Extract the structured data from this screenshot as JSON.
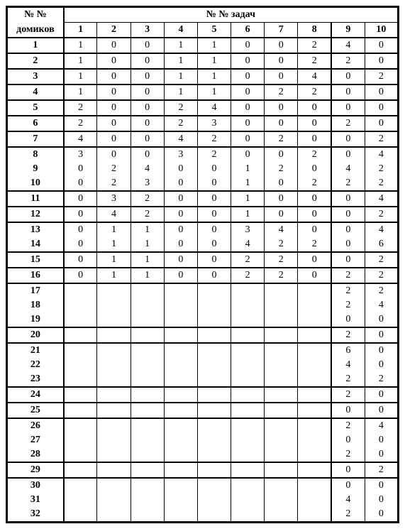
{
  "header": {
    "row_label_top": "№ №",
    "row_label_bottom": "домиков",
    "col_group_label": "№ №  задач",
    "columns": [
      "1",
      "2",
      "3",
      "4",
      "5",
      "6",
      "7",
      "8",
      "9",
      "10"
    ]
  },
  "group_starts": [
    1,
    2,
    3,
    4,
    5,
    6,
    7,
    8,
    11,
    12,
    13,
    15,
    16,
    17,
    20,
    21,
    24,
    25,
    26,
    29,
    30
  ],
  "rows": [
    {
      "n": "1",
      "v": [
        "1",
        "0",
        "0",
        "1",
        "1",
        "0",
        "0",
        "2",
        "4",
        "0"
      ]
    },
    {
      "n": "2",
      "v": [
        "1",
        "0",
        "0",
        "1",
        "1",
        "0",
        "0",
        "2",
        "2",
        "0"
      ]
    },
    {
      "n": "3",
      "v": [
        "1",
        "0",
        "0",
        "1",
        "1",
        "0",
        "0",
        "4",
        "0",
        "2"
      ]
    },
    {
      "n": "4",
      "v": [
        "1",
        "0",
        "0",
        "1",
        "1",
        "0",
        "2",
        "2",
        "0",
        "0"
      ]
    },
    {
      "n": "5",
      "v": [
        "2",
        "0",
        "0",
        "2",
        "4",
        "0",
        "0",
        "0",
        "0",
        "0"
      ]
    },
    {
      "n": "6",
      "v": [
        "2",
        "0",
        "0",
        "2",
        "3",
        "0",
        "0",
        "0",
        "2",
        "0"
      ]
    },
    {
      "n": "7",
      "v": [
        "4",
        "0",
        "0",
        "4",
        "2",
        "0",
        "2",
        "0",
        "0",
        "2"
      ]
    },
    {
      "n": "8",
      "v": [
        "3",
        "0",
        "0",
        "3",
        "2",
        "0",
        "0",
        "2",
        "0",
        "4"
      ]
    },
    {
      "n": "9",
      "v": [
        "0",
        "2",
        "4",
        "0",
        "0",
        "1",
        "2",
        "0",
        "4",
        "2"
      ]
    },
    {
      "n": "10",
      "v": [
        "0",
        "2",
        "3",
        "0",
        "0",
        "1",
        "0",
        "2",
        "2",
        "2"
      ]
    },
    {
      "n": "11",
      "v": [
        "0",
        "3",
        "2",
        "0",
        "0",
        "1",
        "0",
        "0",
        "0",
        "4"
      ]
    },
    {
      "n": "12",
      "v": [
        "0",
        "4",
        "2",
        "0",
        "0",
        "1",
        "0",
        "0",
        "0",
        "2"
      ]
    },
    {
      "n": "13",
      "v": [
        "0",
        "1",
        "1",
        "0",
        "0",
        "3",
        "4",
        "0",
        "0",
        "4"
      ]
    },
    {
      "n": "14",
      "v": [
        "0",
        "1",
        "1",
        "0",
        "0",
        "4",
        "2",
        "2",
        "0",
        "6"
      ]
    },
    {
      "n": "15",
      "v": [
        "0",
        "1",
        "1",
        "0",
        "0",
        "2",
        "2",
        "0",
        "0",
        "2"
      ]
    },
    {
      "n": "16",
      "v": [
        "0",
        "1",
        "1",
        "0",
        "0",
        "2",
        "2",
        "0",
        "2",
        "2"
      ]
    },
    {
      "n": "17",
      "v": [
        "",
        "",
        "",
        "",
        "",
        "",
        "",
        "",
        "2",
        "2"
      ]
    },
    {
      "n": "18",
      "v": [
        "",
        "",
        "",
        "",
        "",
        "",
        "",
        "",
        "2",
        "4"
      ]
    },
    {
      "n": "19",
      "v": [
        "",
        "",
        "",
        "",
        "",
        "",
        "",
        "",
        "0",
        "0"
      ]
    },
    {
      "n": "20",
      "v": [
        "",
        "",
        "",
        "",
        "",
        "",
        "",
        "",
        "2",
        "0"
      ]
    },
    {
      "n": "21",
      "v": [
        "",
        "",
        "",
        "",
        "",
        "",
        "",
        "",
        "6",
        "0"
      ]
    },
    {
      "n": "22",
      "v": [
        "",
        "",
        "",
        "",
        "",
        "",
        "",
        "",
        "4",
        "0"
      ]
    },
    {
      "n": "23",
      "v": [
        "",
        "",
        "",
        "",
        "",
        "",
        "",
        "",
        "2",
        "2"
      ]
    },
    {
      "n": "24",
      "v": [
        "",
        "",
        "",
        "",
        "",
        "",
        "",
        "",
        "2",
        "0"
      ]
    },
    {
      "n": "25",
      "v": [
        "",
        "",
        "",
        "",
        "",
        "",
        "",
        "",
        "0",
        "0"
      ]
    },
    {
      "n": "26",
      "v": [
        "",
        "",
        "",
        "",
        "",
        "",
        "",
        "",
        "2",
        "4"
      ]
    },
    {
      "n": "27",
      "v": [
        "",
        "",
        "",
        "",
        "",
        "",
        "",
        "",
        "0",
        "0"
      ]
    },
    {
      "n": "28",
      "v": [
        "",
        "",
        "",
        "",
        "",
        "",
        "",
        "",
        "2",
        "0"
      ]
    },
    {
      "n": "29",
      "v": [
        "",
        "",
        "",
        "",
        "",
        "",
        "",
        "",
        "0",
        "2"
      ]
    },
    {
      "n": "30",
      "v": [
        "",
        "",
        "",
        "",
        "",
        "",
        "",
        "",
        "0",
        "0"
      ]
    },
    {
      "n": "31",
      "v": [
        "",
        "",
        "",
        "",
        "",
        "",
        "",
        "",
        "4",
        "0"
      ]
    },
    {
      "n": "32",
      "v": [
        "",
        "",
        "",
        "",
        "",
        "",
        "",
        "",
        "2",
        "0"
      ]
    }
  ]
}
